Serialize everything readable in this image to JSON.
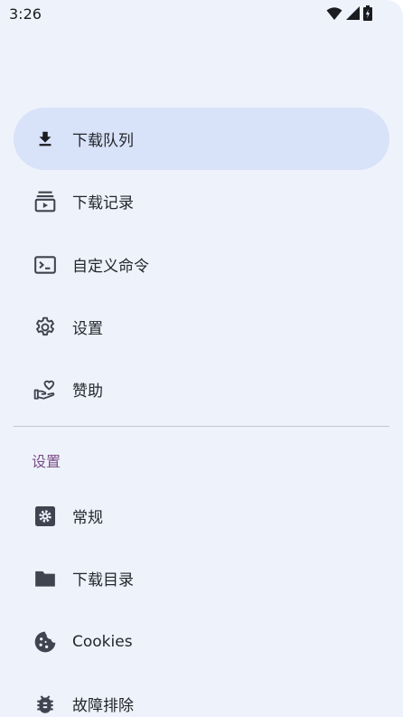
{
  "status_bar": {
    "time": "3:26"
  },
  "nav": {
    "items": [
      {
        "label": "下载队列",
        "icon": "download-icon",
        "active": true
      },
      {
        "label": "下载记录",
        "icon": "subscriptions-icon"
      },
      {
        "label": "自定义命令",
        "icon": "terminal-icon"
      },
      {
        "label": "设置",
        "icon": "gear-icon"
      },
      {
        "label": "赞助",
        "icon": "volunteer-heart-icon"
      }
    ]
  },
  "settings_section": {
    "header": "设置",
    "items": [
      {
        "label": "常规",
        "icon": "settings-box-icon"
      },
      {
        "label": "下载目录",
        "icon": "folder-icon"
      },
      {
        "label": "Cookies",
        "icon": "cookie-icon"
      },
      {
        "label": "故障排除",
        "icon": "bug-icon"
      }
    ]
  },
  "colors": {
    "drawer_bg": "#eef2fb",
    "active_bg": "#d8e2f8",
    "section_header": "#7a4f86",
    "icon": "#3f4450"
  }
}
